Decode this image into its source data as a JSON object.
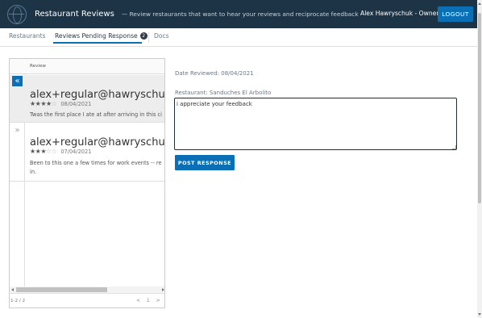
{
  "header": {
    "app_title": "Restaurant Reviews",
    "app_subtitle": "— Review restaurants that want to hear your reviews and reciprocate feedback",
    "user_name": "Alex Hawryschuk - Owner",
    "logout_label": "LOGOUT"
  },
  "tabs": [
    {
      "label": "Restaurants"
    },
    {
      "label": "Reviews Pending Response",
      "badge": "2"
    },
    {
      "label": "Docs"
    }
  ],
  "grid": {
    "column_header": "Review",
    "rows": [
      {
        "email": "alex+regular@hawryschuk.com",
        "rating": 4,
        "date": "08/04/2021",
        "text": "Twas the first place I ate at after arriving in this ci"
      },
      {
        "email": "alex+regular@hawryschuk.com",
        "rating": 3,
        "date": "07/04/2021",
        "text": "Been to this one a few times for work events -- re in."
      }
    ],
    "pager_count": "1-2 / 2",
    "pager_nav": "< 1 >"
  },
  "detail": {
    "date_reviewed": "Date Reviewed: 08/04/2021",
    "restaurant": "Restaurant: Sanduches El Arbolito",
    "response_value": "i appreciate your feedback",
    "post_label": "POST RESPONSE"
  },
  "colors": {
    "header_bg": "#1d3346",
    "accent": "#0a6fb5"
  }
}
